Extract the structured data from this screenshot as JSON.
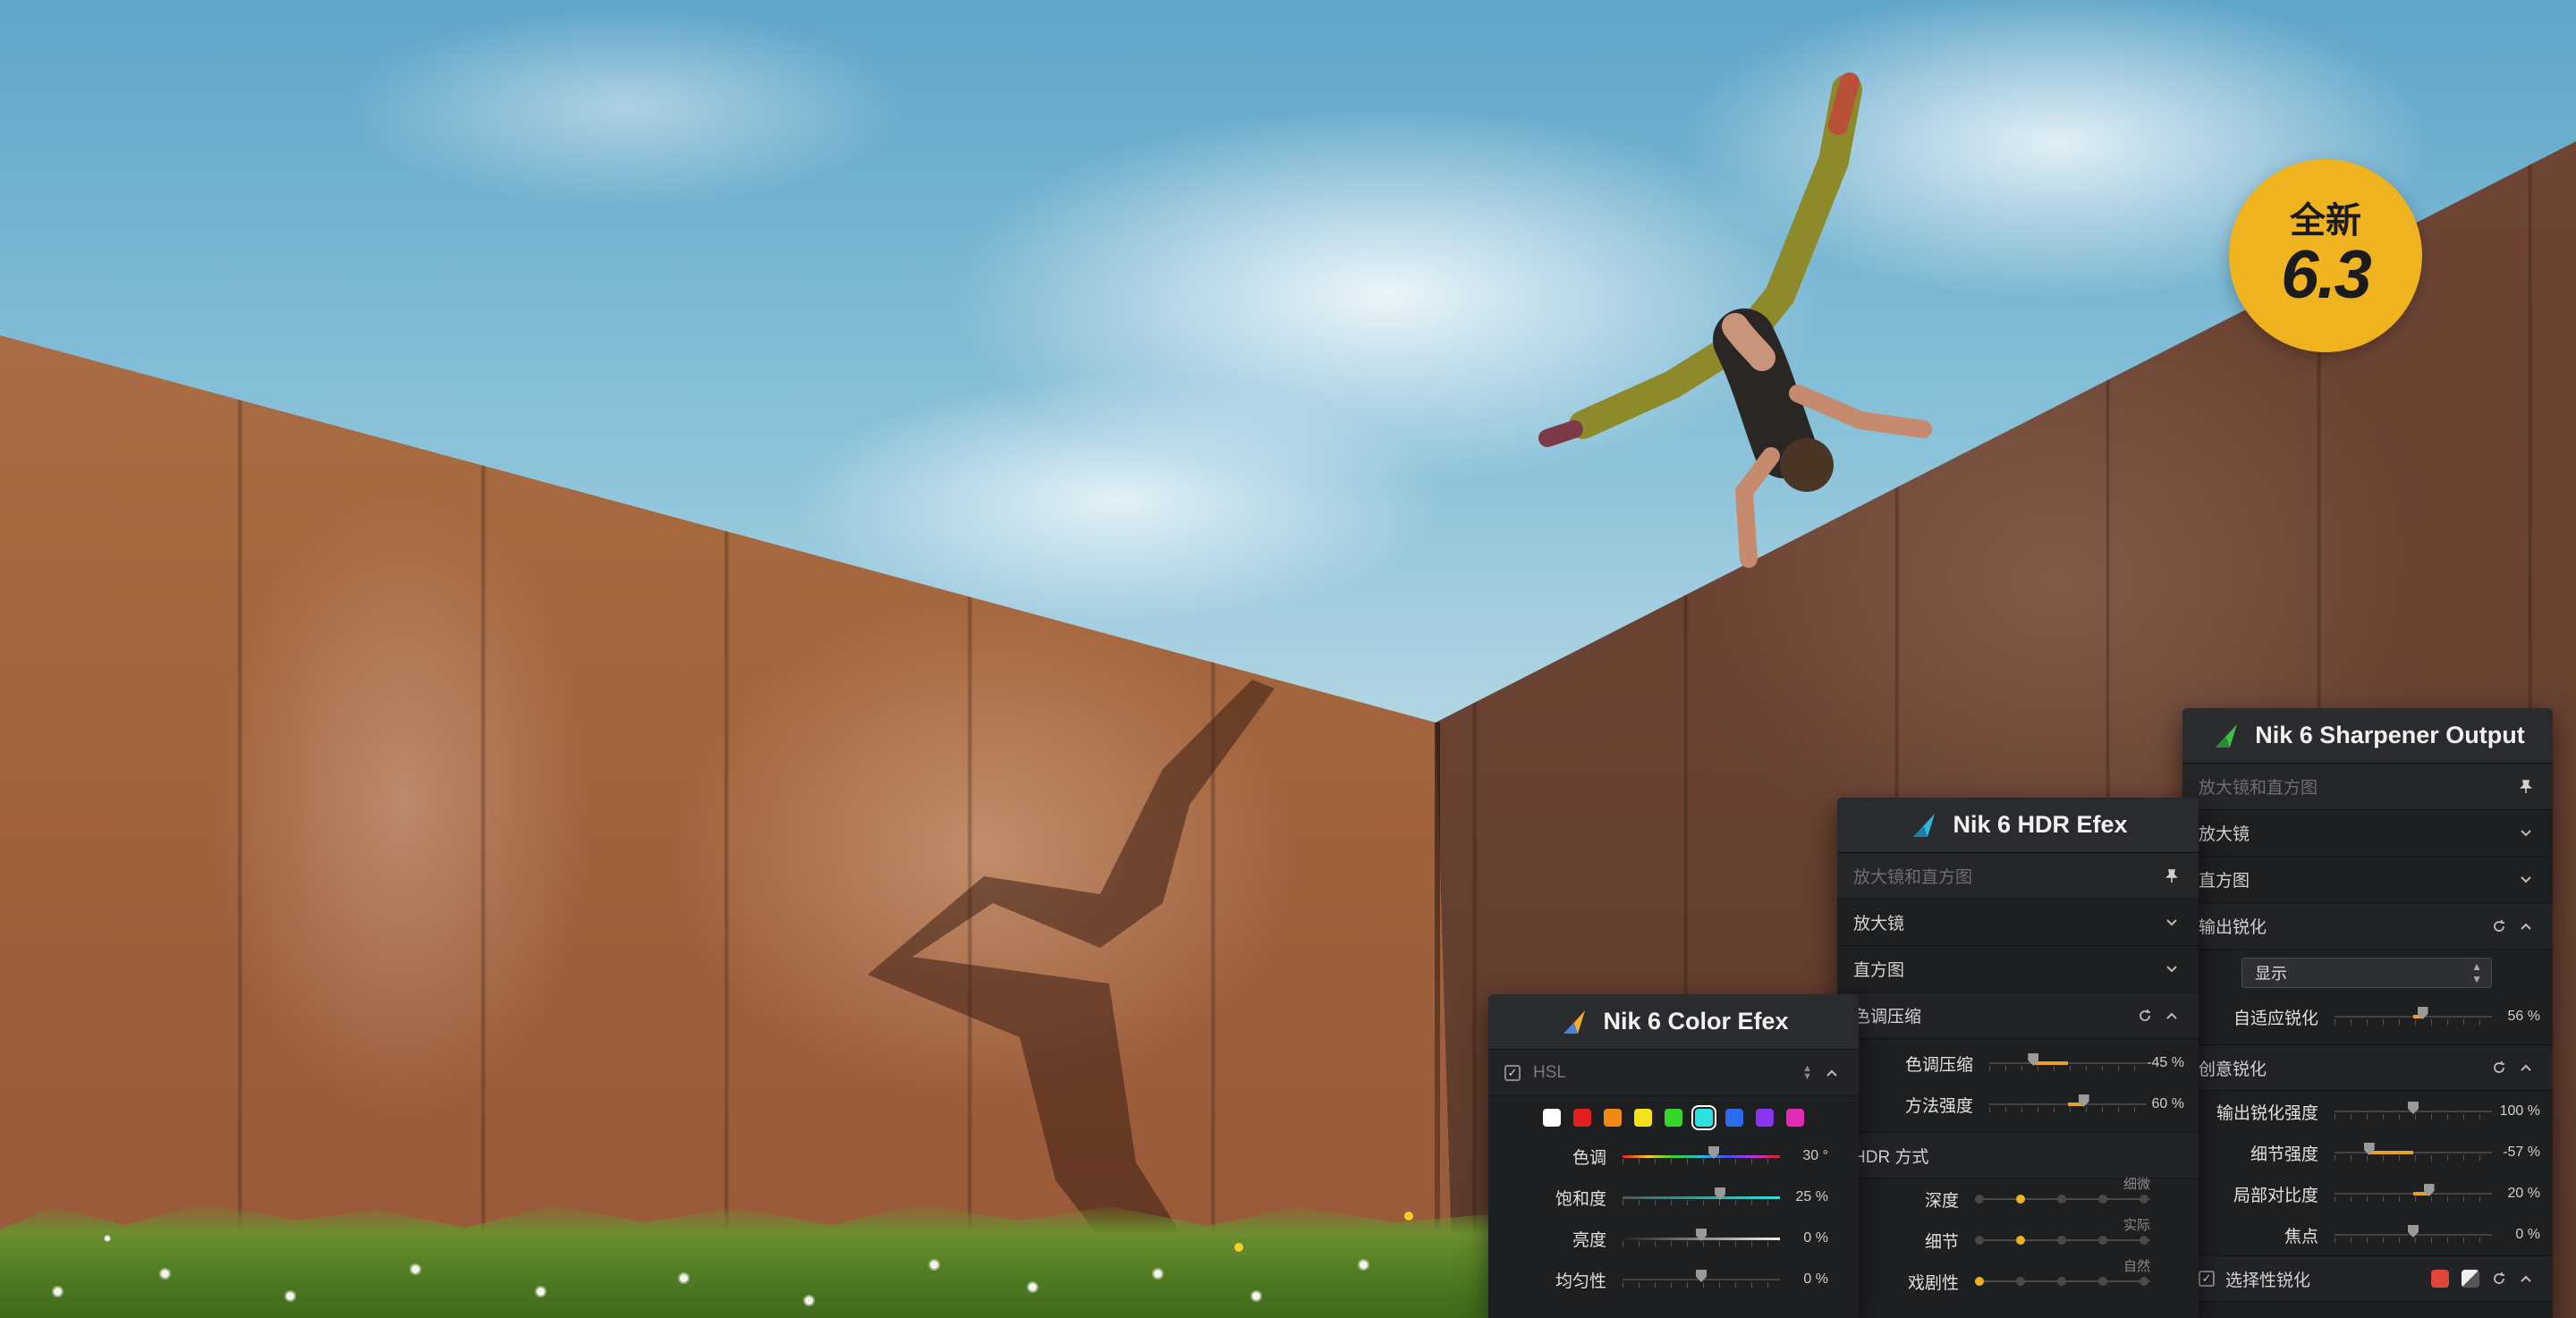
{
  "badge": {
    "top": "全新",
    "version": "6.3"
  },
  "color_efex": {
    "title": "Nik 6 Color Efex",
    "section_label": "HSL",
    "swatches": [
      "#ffffff",
      "#e02020",
      "#f08a10",
      "#f2e21a",
      "#35d629",
      "#2fe0e0",
      "#2b6cf2",
      "#8c35f0",
      "#e02bb8"
    ],
    "selected_swatch": 5,
    "sliders": [
      {
        "label": "色调",
        "value": "30 °",
        "pos": 0.58,
        "type": "hue"
      },
      {
        "label": "饱和度",
        "value": "25 %",
        "pos": 0.62,
        "type": "sat"
      },
      {
        "label": "亮度",
        "value": "0 %",
        "pos": 0.5,
        "type": "lum"
      },
      {
        "label": "均匀性",
        "value": "0 %",
        "pos": 0.5,
        "type": "plain"
      }
    ]
  },
  "hdr_efex": {
    "title": "Nik 6 HDR Efex",
    "rows": {
      "loupe_histogram": "放大镜和直方图",
      "loupe": "放大镜",
      "histogram": "直方图",
      "tone_compression_section": "色调压缩",
      "hdr_method_section": "HDR 方式"
    },
    "sliders": [
      {
        "label": "色调压缩",
        "value": "-45 %",
        "pos": 0.28
      },
      {
        "label": "方法强度",
        "value": "60 %",
        "pos": 0.6
      }
    ],
    "methods": [
      {
        "label": "深度",
        "caption": "细微",
        "active": 1
      },
      {
        "label": "细节",
        "caption": "实际",
        "active": 1
      },
      {
        "label": "戏剧性",
        "caption": "自然",
        "active": 0
      }
    ]
  },
  "sharpener": {
    "title": "Nik 6 Sharpener Output",
    "rows": {
      "loupe_histogram": "放大镜和直方图",
      "loupe": "放大镜",
      "histogram": "直方图",
      "output_section": "输出锐化",
      "creative_section": "创意锐化",
      "selective": "选择性锐化"
    },
    "display_select": "显示",
    "adaptive": {
      "label": "自适应锐化",
      "value": "56 %",
      "pos": 0.56
    },
    "sliders": [
      {
        "label": "输出锐化强度",
        "value": "100 %",
        "pos": 0.5
      },
      {
        "label": "细节强度",
        "value": "-57 %",
        "pos": 0.22
      },
      {
        "label": "局部对比度",
        "value": "20 %",
        "pos": 0.6
      },
      {
        "label": "焦点",
        "value": "0 %",
        "pos": 0.5
      }
    ],
    "colors": {
      "red_dot": "#e0453a"
    }
  }
}
